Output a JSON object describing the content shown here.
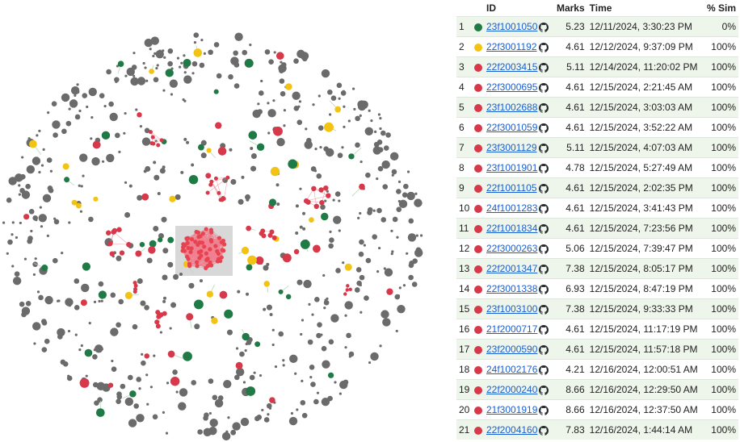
{
  "colors": {
    "red": "#d7384a",
    "green": "#1f7a46",
    "yellow": "#f2c312",
    "gray": "#6b6b6b",
    "link": "#1a5fd0"
  },
  "table": {
    "headers": {
      "index": "",
      "id": "ID",
      "marks": "Marks",
      "time": "Time",
      "sim": "% Sim"
    },
    "rows": [
      {
        "n": "1",
        "status": "green",
        "id": "23f1001050",
        "marks": "5.23",
        "time": "12/11/2024, 3:30:23 PM",
        "sim": "0%"
      },
      {
        "n": "2",
        "status": "yellow",
        "id": "22f3001192",
        "marks": "4.61",
        "time": "12/12/2024, 9:37:09 PM",
        "sim": "100%"
      },
      {
        "n": "3",
        "status": "red",
        "id": "22f2003415",
        "marks": "5.11",
        "time": "12/14/2024, 11:20:02 PM",
        "sim": "100%"
      },
      {
        "n": "4",
        "status": "red",
        "id": "22f3000695",
        "marks": "4.61",
        "time": "12/15/2024, 2:21:45 AM",
        "sim": "100%"
      },
      {
        "n": "5",
        "status": "red",
        "id": "23f1002688",
        "marks": "4.61",
        "time": "12/15/2024, 3:03:03 AM",
        "sim": "100%"
      },
      {
        "n": "6",
        "status": "red",
        "id": "22f3001059",
        "marks": "4.61",
        "time": "12/15/2024, 3:52:22 AM",
        "sim": "100%"
      },
      {
        "n": "7",
        "status": "red",
        "id": "23f3001129",
        "marks": "5.11",
        "time": "12/15/2024, 4:07:03 AM",
        "sim": "100%"
      },
      {
        "n": "8",
        "status": "red",
        "id": "23f1001901",
        "marks": "4.78",
        "time": "12/15/2024, 5:27:49 AM",
        "sim": "100%"
      },
      {
        "n": "9",
        "status": "red",
        "id": "22f1001105",
        "marks": "4.61",
        "time": "12/15/2024, 2:02:35 PM",
        "sim": "100%"
      },
      {
        "n": "10",
        "status": "red",
        "id": "24f1001283",
        "marks": "4.61",
        "time": "12/15/2024, 3:41:43 PM",
        "sim": "100%"
      },
      {
        "n": "11",
        "status": "red",
        "id": "22f1001834",
        "marks": "4.61",
        "time": "12/15/2024, 7:23:56 PM",
        "sim": "100%"
      },
      {
        "n": "12",
        "status": "red",
        "id": "22f3000263",
        "marks": "5.06",
        "time": "12/15/2024, 7:39:47 PM",
        "sim": "100%"
      },
      {
        "n": "13",
        "status": "red",
        "id": "22f2001347",
        "marks": "7.38",
        "time": "12/15/2024, 8:05:17 PM",
        "sim": "100%"
      },
      {
        "n": "14",
        "status": "red",
        "id": "22f3001338",
        "marks": "6.93",
        "time": "12/15/2024, 8:47:19 PM",
        "sim": "100%"
      },
      {
        "n": "15",
        "status": "red",
        "id": "23f1003100",
        "marks": "7.38",
        "time": "12/15/2024, 9:33:33 PM",
        "sim": "100%"
      },
      {
        "n": "16",
        "status": "red",
        "id": "21f2000717",
        "marks": "4.61",
        "time": "12/15/2024, 11:17:19 PM",
        "sim": "100%"
      },
      {
        "n": "17",
        "status": "red",
        "id": "23f2000590",
        "marks": "4.61",
        "time": "12/15/2024, 11:57:18 PM",
        "sim": "100%"
      },
      {
        "n": "18",
        "status": "red",
        "id": "24f1002176",
        "marks": "4.21",
        "time": "12/16/2024, 12:00:51 AM",
        "sim": "100%"
      },
      {
        "n": "19",
        "status": "red",
        "id": "22f2000240",
        "marks": "8.66",
        "time": "12/16/2024, 12:29:50 AM",
        "sim": "100%"
      },
      {
        "n": "20",
        "status": "red",
        "id": "21f3001919",
        "marks": "8.66",
        "time": "12/16/2024, 12:37:50 AM",
        "sim": "100%"
      },
      {
        "n": "21",
        "status": "red",
        "id": "22f2004160",
        "marks": "7.83",
        "time": "12/16/2024, 1:44:14 AM",
        "sim": "100%"
      }
    ]
  }
}
